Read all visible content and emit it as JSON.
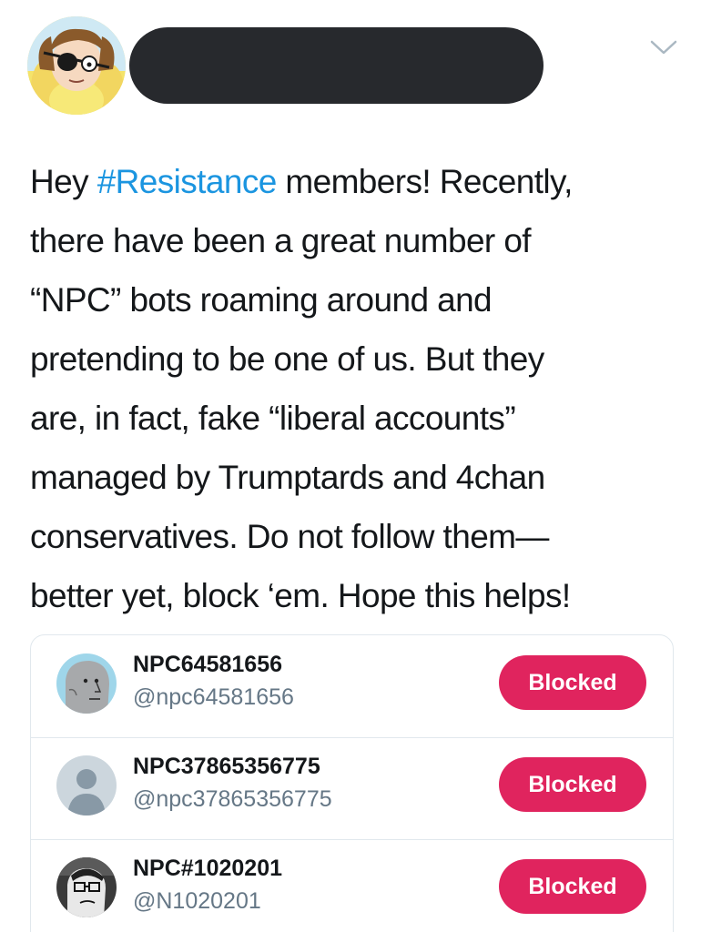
{
  "header": {
    "chevron_icon": "chevron-down-icon",
    "avatar_icon": "cartoon-character-avatar",
    "name_redacted": true
  },
  "tweet": {
    "lines": [
      {
        "pre": "Hey ",
        "hashtag": "#Resistance",
        "post": " members! Recently,"
      },
      {
        "text": "there have been a great number of"
      },
      {
        "text": "“NPC” bots roaming around and"
      },
      {
        "text": "pretending to be one of us. But they"
      },
      {
        "text": "are, in fact, fake “liberal accounts”"
      },
      {
        "text": "managed by Trumptards and 4chan"
      },
      {
        "text": "conservatives. Do not follow them—"
      },
      {
        "text": "better yet, block ‘em. Hope this helps!"
      }
    ],
    "hashtag_color": "#1b95e0"
  },
  "blocked_list": {
    "accent_color": "#e0245e",
    "users": [
      {
        "name": "NPC64581656",
        "handle": "@npc64581656",
        "button": "Blocked",
        "avatar": "npc-wojak-avatar"
      },
      {
        "name": "NPC37865356775",
        "handle": "@npc37865356775",
        "button": "Blocked",
        "avatar": "default-profile-avatar"
      },
      {
        "name": "NPC#1020201",
        "handle": "@N1020201",
        "button": "Blocked",
        "avatar": "npc-glasses-avatar"
      }
    ]
  }
}
